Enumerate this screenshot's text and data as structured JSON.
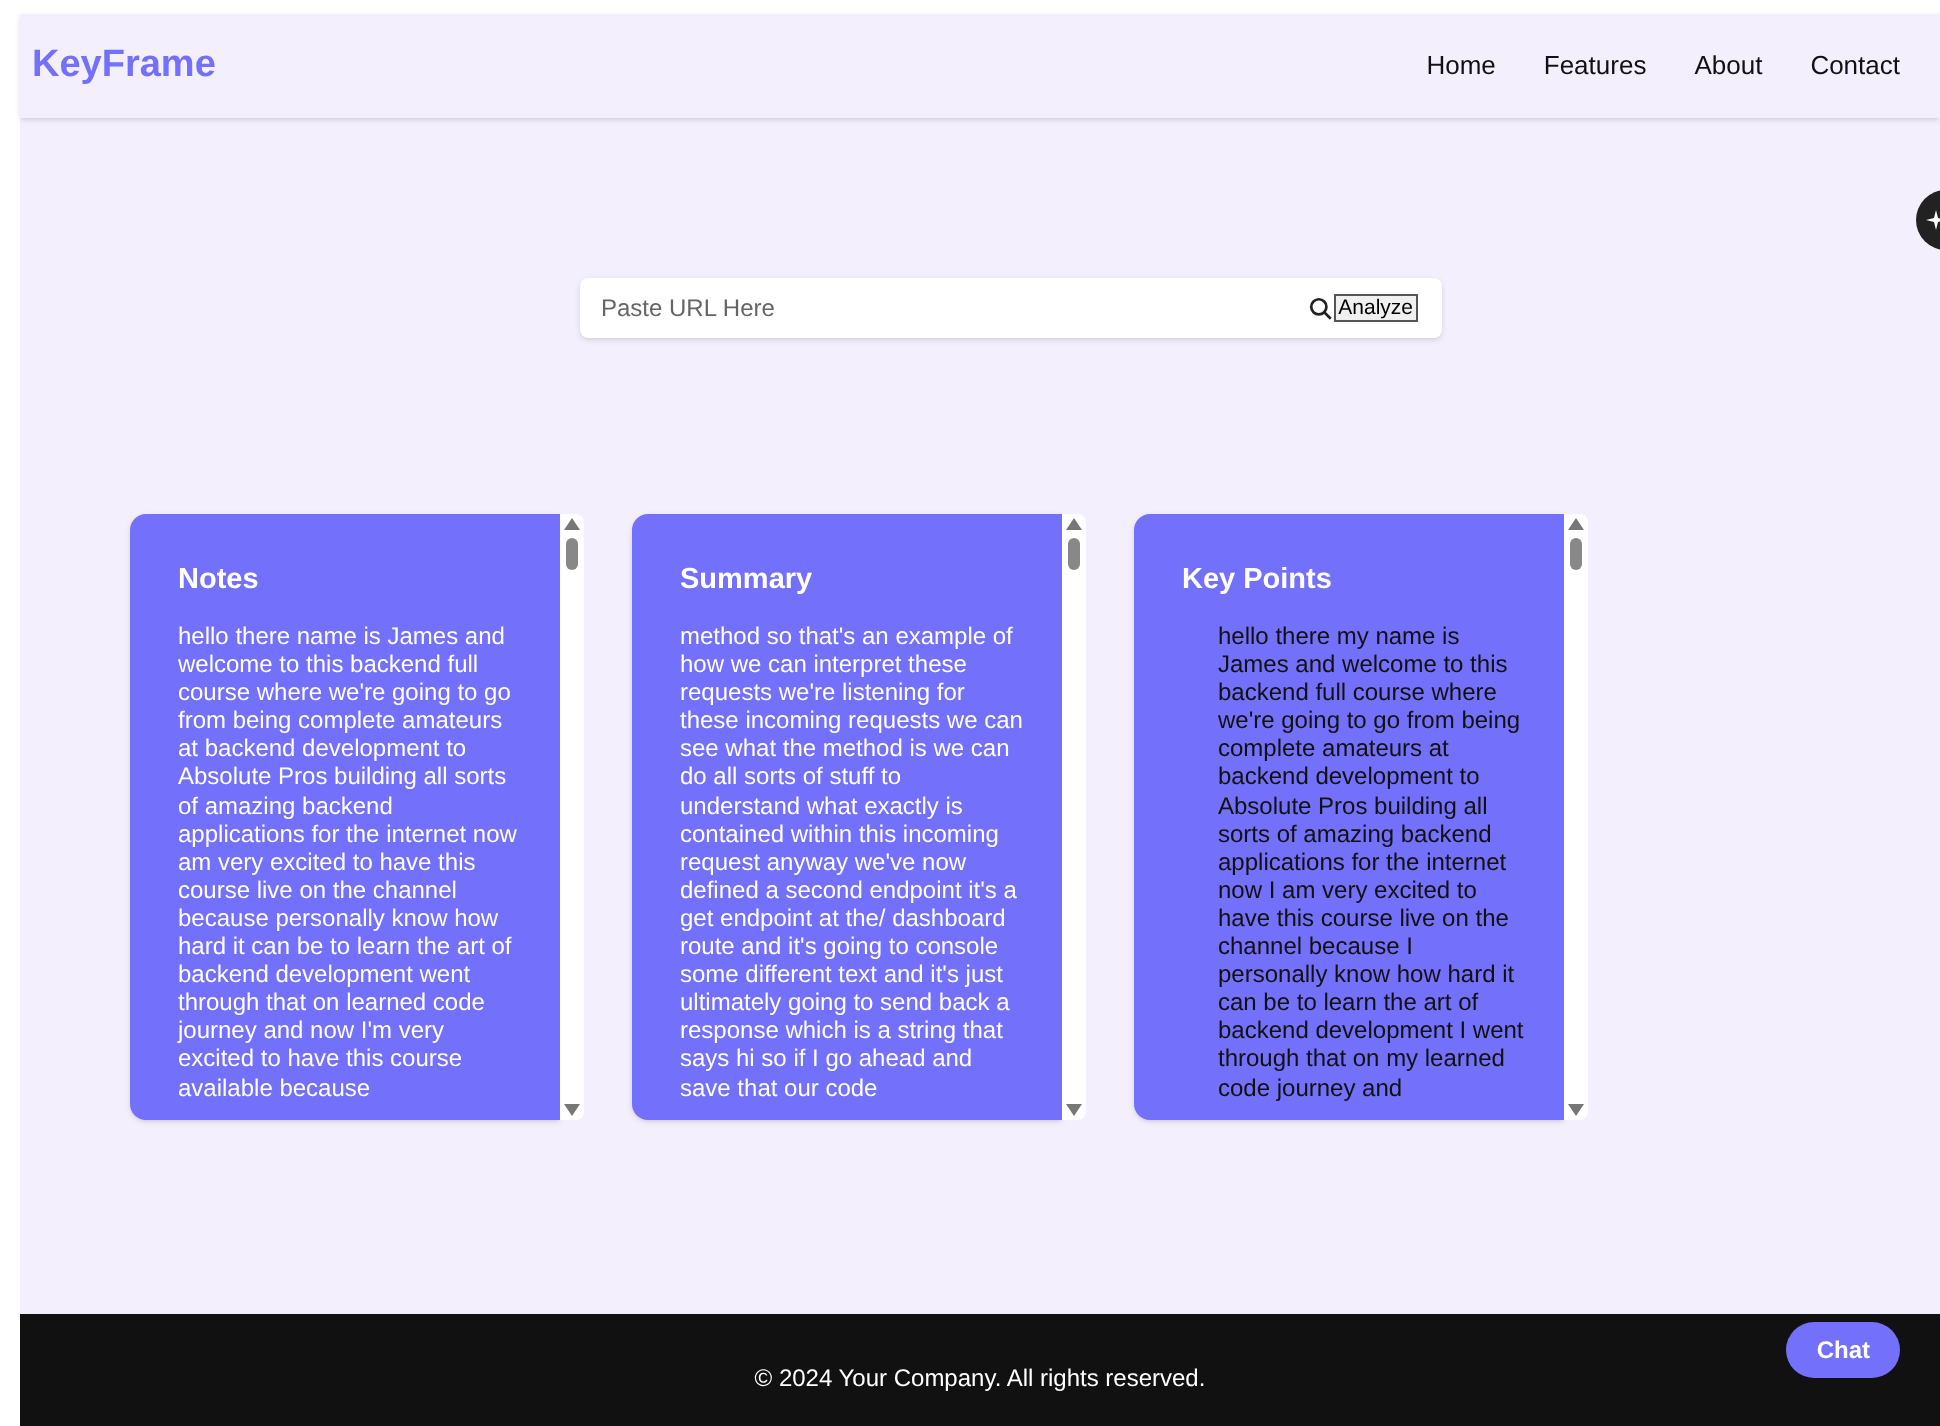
{
  "header": {
    "logo": "KeyFrame",
    "nav": [
      {
        "label": "Home"
      },
      {
        "label": "Features"
      },
      {
        "label": "About"
      },
      {
        "label": "Contact"
      }
    ]
  },
  "search": {
    "placeholder": "Paste URL Here",
    "button": "Analyze"
  },
  "cards": [
    {
      "title": "Notes",
      "kind": "paragraph",
      "text": "hello there name is James and welcome to this backend full course where we're going to go from being complete amateurs at backend development to Absolute Pros building all sorts of amazing backend applications for the internet now am very excited to have this course live on the channel because personally know how hard it can be to learn the art of backend development went through that on learned code journey and now I'm very excited to have this course available because"
    },
    {
      "title": "Summary",
      "kind": "paragraph",
      "text": "method so that's an example of how we can interpret these requests we're listening for these incoming requests we can see what the method is we can do all sorts of stuff to understand what exactly is contained within this incoming request anyway we've now defined a second endpoint it's a get endpoint at the/ dashboard route and it's going to console some different text and it's just ultimately going to send back a response which is a string that says hi so if I go ahead and save that our code"
    },
    {
      "title": "Key Points",
      "kind": "list",
      "text": "hello there my name is James and welcome to this backend full course where we're going to go from being complete amateurs at backend development to Absolute Pros building all sorts of amazing backend applications for the internet now I am very excited to have this course live on the channel because I personally know how hard it can be to learn the art of backend development I went through that on my learned code journey and"
    }
  ],
  "footer": {
    "text": "© 2024 Your Company. All rights reserved.",
    "chat": "Chat"
  }
}
